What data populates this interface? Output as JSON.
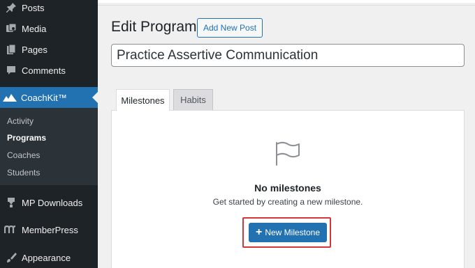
{
  "sidebar": {
    "items": [
      {
        "label": "Posts",
        "icon": "pin-icon"
      },
      {
        "label": "Media",
        "icon": "media-icon"
      },
      {
        "label": "Pages",
        "icon": "pages-icon"
      },
      {
        "label": "Comments",
        "icon": "comment-icon"
      },
      {
        "label": "CoachKit™",
        "icon": "mountain-icon"
      },
      {
        "label": "MP Downloads",
        "icon": "download-icon"
      },
      {
        "label": "MemberPress",
        "icon": "memberpress-icon"
      },
      {
        "label": "Appearance",
        "icon": "brush-icon"
      }
    ],
    "submenu": [
      "Activity",
      "Programs",
      "Coaches",
      "Students"
    ]
  },
  "header": {
    "title": "Edit Program",
    "add_new_label": "Add New Post"
  },
  "post_title": "Practice Assertive Communication",
  "tabs": [
    "Milestones",
    "Habits"
  ],
  "empty_state": {
    "title": "No milestones",
    "subtitle": "Get started by creating a new milestone.",
    "button_label": "New Milestone"
  },
  "colors": {
    "accent": "#2271b1",
    "sidebar": "#1d2327",
    "highlight": "#d63638"
  }
}
